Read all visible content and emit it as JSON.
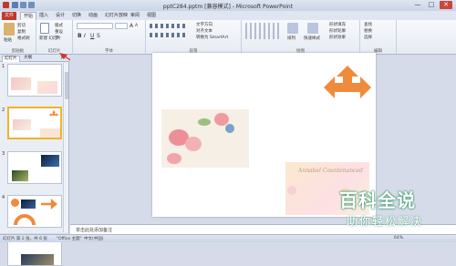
{
  "window": {
    "title": "pptC284.pptm [兼容模式] - Microsoft PowerPoint",
    "minimize": "—",
    "maximize": "□",
    "close": "✕"
  },
  "ribbon_tabs": [
    "文件",
    "开始",
    "插入",
    "设计",
    "切换",
    "动画",
    "幻灯片放映",
    "审阅",
    "视图"
  ],
  "ribbon": {
    "clipboard": {
      "label": "剪贴板",
      "paste": "粘贴",
      "cut": "剪切",
      "copy": "复制",
      "format_painter": "格式刷"
    },
    "slides": {
      "label": "幻灯片",
      "new_slide": "新建\n幻灯片",
      "layout": "版式",
      "reset": "重设",
      "section": "节"
    },
    "font": {
      "label": "字体",
      "bold": "B",
      "italic": "I",
      "underline": "U",
      "strike": "S",
      "size_up": "A",
      "size_down": "A"
    },
    "paragraph": {
      "label": "段落",
      "text_direction": "文字方向",
      "align_text": "对齐文本",
      "smartart": "转换为 SmartArt"
    },
    "drawing": {
      "label": "绘图",
      "arrange": "排列",
      "quick_styles": "快速样式",
      "shape_fill": "形状填充",
      "shape_outline": "形状轮廓",
      "shape_effects": "形状效果"
    },
    "editing": {
      "label": "编辑",
      "find": "查找",
      "replace": "替换",
      "select": "选择"
    }
  },
  "panel": {
    "tabs": [
      "幻灯片",
      "大纲"
    ],
    "slides": [
      {
        "num": "1"
      },
      {
        "num": "2"
      },
      {
        "num": "3"
      },
      {
        "num": "4"
      },
      {
        "num": "5"
      }
    ]
  },
  "slide": {
    "card_script": "Annabel Countenanced"
  },
  "notes": {
    "placeholder": "单击此处添加备注"
  },
  "status": {
    "slide_info": "幻灯片 第 2 张，共 6 张",
    "theme": "\"Office 主题\"",
    "language": "中文(中国)",
    "zoom": "64%"
  },
  "watermark": {
    "line1": "百科全说",
    "line2": "助你轻松解决"
  },
  "colors": {
    "arrow_orange": "#f08a3c",
    "file_tab": "#c0392b",
    "selection": "#f0b429",
    "annotation_arrow": "#d9342b"
  }
}
